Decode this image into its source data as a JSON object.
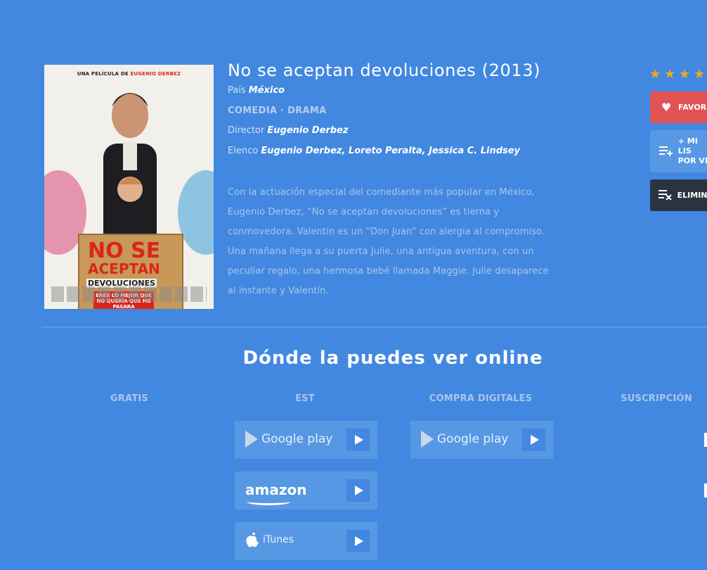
{
  "movie": {
    "title": "No se aceptan devoluciones (2013)",
    "country_label": "País",
    "country": "México",
    "genres": "COMEDIA · DRAMA",
    "director_label": "Director",
    "director": "Eugenio Derbez",
    "cast_label": "Elenco",
    "cast": "Eugenio Derbez, Loreto Peralta, Jessica C. Lindsey",
    "synopsis": "Con la actuación especial del comediante más popular en México, Eugenio Derbez, “No se aceptan devoluciones” es tierna y conmovedora. Valentín es un “Don Juan” con alergia al compromiso. Una mañana llega a su puerta Julie, una antigua aventura, con un peculiar regalo, una hermosa bebé llamada Maggie. Julie desaparece al instante y Valentín.",
    "rating_stars": 4
  },
  "poster": {
    "top_credit_prefix": "UNA PELÍCULA DE",
    "top_credit_name": "EUGENIO DERBEZ",
    "logo_line1": "NO SE",
    "logo_line2": "ACEPTAN",
    "logo_line3": "DEVOLUCIONES",
    "tagline": "ERES LO MEJOR QUE NO QUERÍA QUE ME PASARA"
  },
  "actions": {
    "favorite": "FAVORI",
    "list_line1": "+ MI LIS",
    "list_line2": "POR VE",
    "remove": "ELIMINA"
  },
  "online": {
    "section_title": "Dónde la puedes ver online",
    "columns": [
      "GRATIS",
      "EST",
      "COMPRA DIGITALES",
      "SUSCRIPCIÓN"
    ],
    "stores": {
      "google_play": "Google play",
      "amazon": "amazon",
      "itunes": "iTunes"
    }
  },
  "colors": {
    "background": "#4288e0",
    "favorite": "#e25255",
    "remove": "#2a3441",
    "star": "#f5a623"
  }
}
